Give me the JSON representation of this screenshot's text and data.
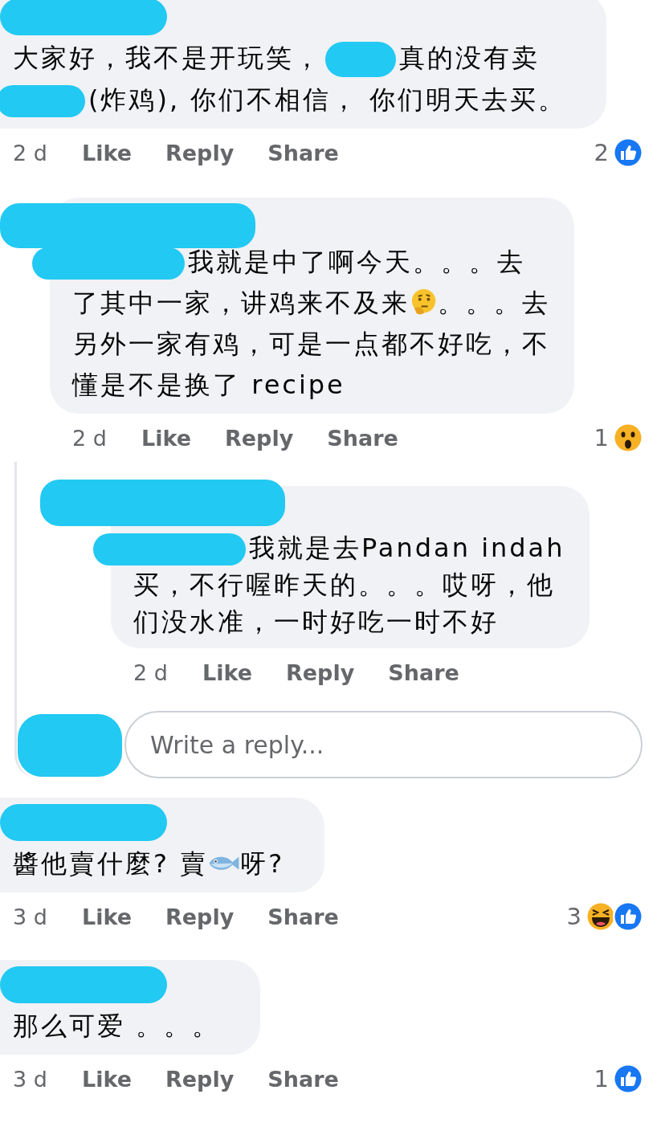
{
  "comments": [
    {
      "lines": [
        [
          {
            "kind": "text",
            "text": "大家好，我不是开玩笑，"
          },
          {
            "kind": "redaction"
          },
          {
            "kind": "text",
            "text": "真的没有卖"
          }
        ],
        [
          {
            "kind": "redaction"
          },
          {
            "kind": "text",
            "text": "(炸鸡), 你们不相信， 你们明天去买。"
          }
        ]
      ],
      "time": "2 d",
      "actions": [
        "Like",
        "Reply",
        "Share"
      ],
      "reactions": {
        "count": "2",
        "icons": [
          {
            "kind": "like"
          }
        ]
      },
      "replies": [
        {
          "lines": [
            [
              {
                "kind": "redaction"
              },
              {
                "kind": "text",
                "text": "我就是中了啊今天。。。去"
              }
            ],
            [
              {
                "kind": "text",
                "text": "了其中一家，讲鸡来不及来"
              },
              {
                "kind": "thinking-face"
              },
              {
                "kind": "text",
                "text": "。。。去"
              }
            ],
            [
              {
                "kind": "text",
                "text": "另外一家有鸡，可是一点都不好吃，不"
              }
            ],
            [
              {
                "kind": "text",
                "text": "懂是不是换了 recipe"
              }
            ]
          ],
          "time": "2 d",
          "actions": [
            "Like",
            "Reply",
            "Share"
          ],
          "reactions": {
            "count": "1",
            "icons": [
              {
                "kind": "wow"
              }
            ]
          },
          "replies": [
            {
              "lines": [
                [
                  {
                    "kind": "redaction"
                  },
                  {
                    "kind": "text",
                    "text": "我就是去Pandan indah"
                  }
                ],
                [
                  {
                    "kind": "text",
                    "text": "买，不行喔昨天的。。。哎呀，他"
                  }
                ],
                [
                  {
                    "kind": "text",
                    "text": "们没水准，一时好吃一时不好"
                  }
                ]
              ],
              "time": "2 d",
              "actions": [
                "Like",
                "Reply",
                "Share"
              ]
            }
          ],
          "reply_field": {
            "placeholder": "Write a reply..."
          }
        }
      ]
    },
    {
      "lines": [
        [
          {
            "kind": "text",
            "text": "醬他賣什麼? 賣"
          },
          {
            "kind": "fish"
          },
          {
            "kind": "text",
            "text": "呀?"
          }
        ]
      ],
      "time": "3 d",
      "actions": [
        "Like",
        "Reply",
        "Share"
      ],
      "reactions": {
        "count": "3",
        "icons": [
          {
            "kind": "haha"
          },
          {
            "kind": "like"
          }
        ]
      }
    },
    {
      "lines": [
        [
          {
            "kind": "text",
            "text": "那么可爱 。。。"
          }
        ]
      ],
      "time": "3 d",
      "actions": [
        "Like",
        "Reply",
        "Share"
      ],
      "reactions": {
        "count": "1",
        "icons": [
          {
            "kind": "like"
          }
        ]
      }
    }
  ]
}
